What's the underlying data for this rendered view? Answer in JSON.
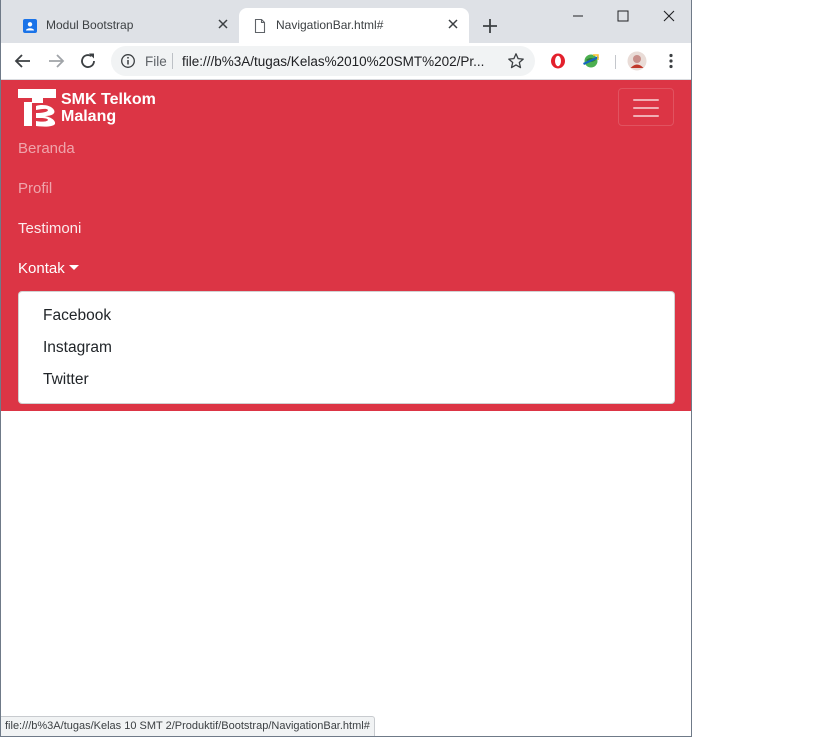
{
  "browser": {
    "tabs": [
      {
        "title": "Modul Bootstrap",
        "icon": "classroom-icon",
        "active": false
      },
      {
        "title": "NavigationBar.html#",
        "icon": "document-icon",
        "active": true
      }
    ],
    "omnibox": {
      "scheme": "File",
      "url": "file:///b%3A/tugas/Kelas%2010%20SMT%202/Pr..."
    },
    "status_url": "file:///b%3A/tugas/Kelas 10 SMT 2/Produktif/Bootstrap/NavigationBar.html#"
  },
  "navbar": {
    "brand_line1": "SMK Telkom",
    "brand_line2": "Malang",
    "color": "#dc3545",
    "links": [
      {
        "label": "Beranda",
        "state": "muted"
      },
      {
        "label": "Profil",
        "state": "muted"
      },
      {
        "label": "Testimoni",
        "state": "normal"
      },
      {
        "label": "Kontak",
        "state": "active-dropdown"
      }
    ],
    "dropdown_items": [
      "Facebook",
      "Instagram",
      "Twitter"
    ]
  }
}
